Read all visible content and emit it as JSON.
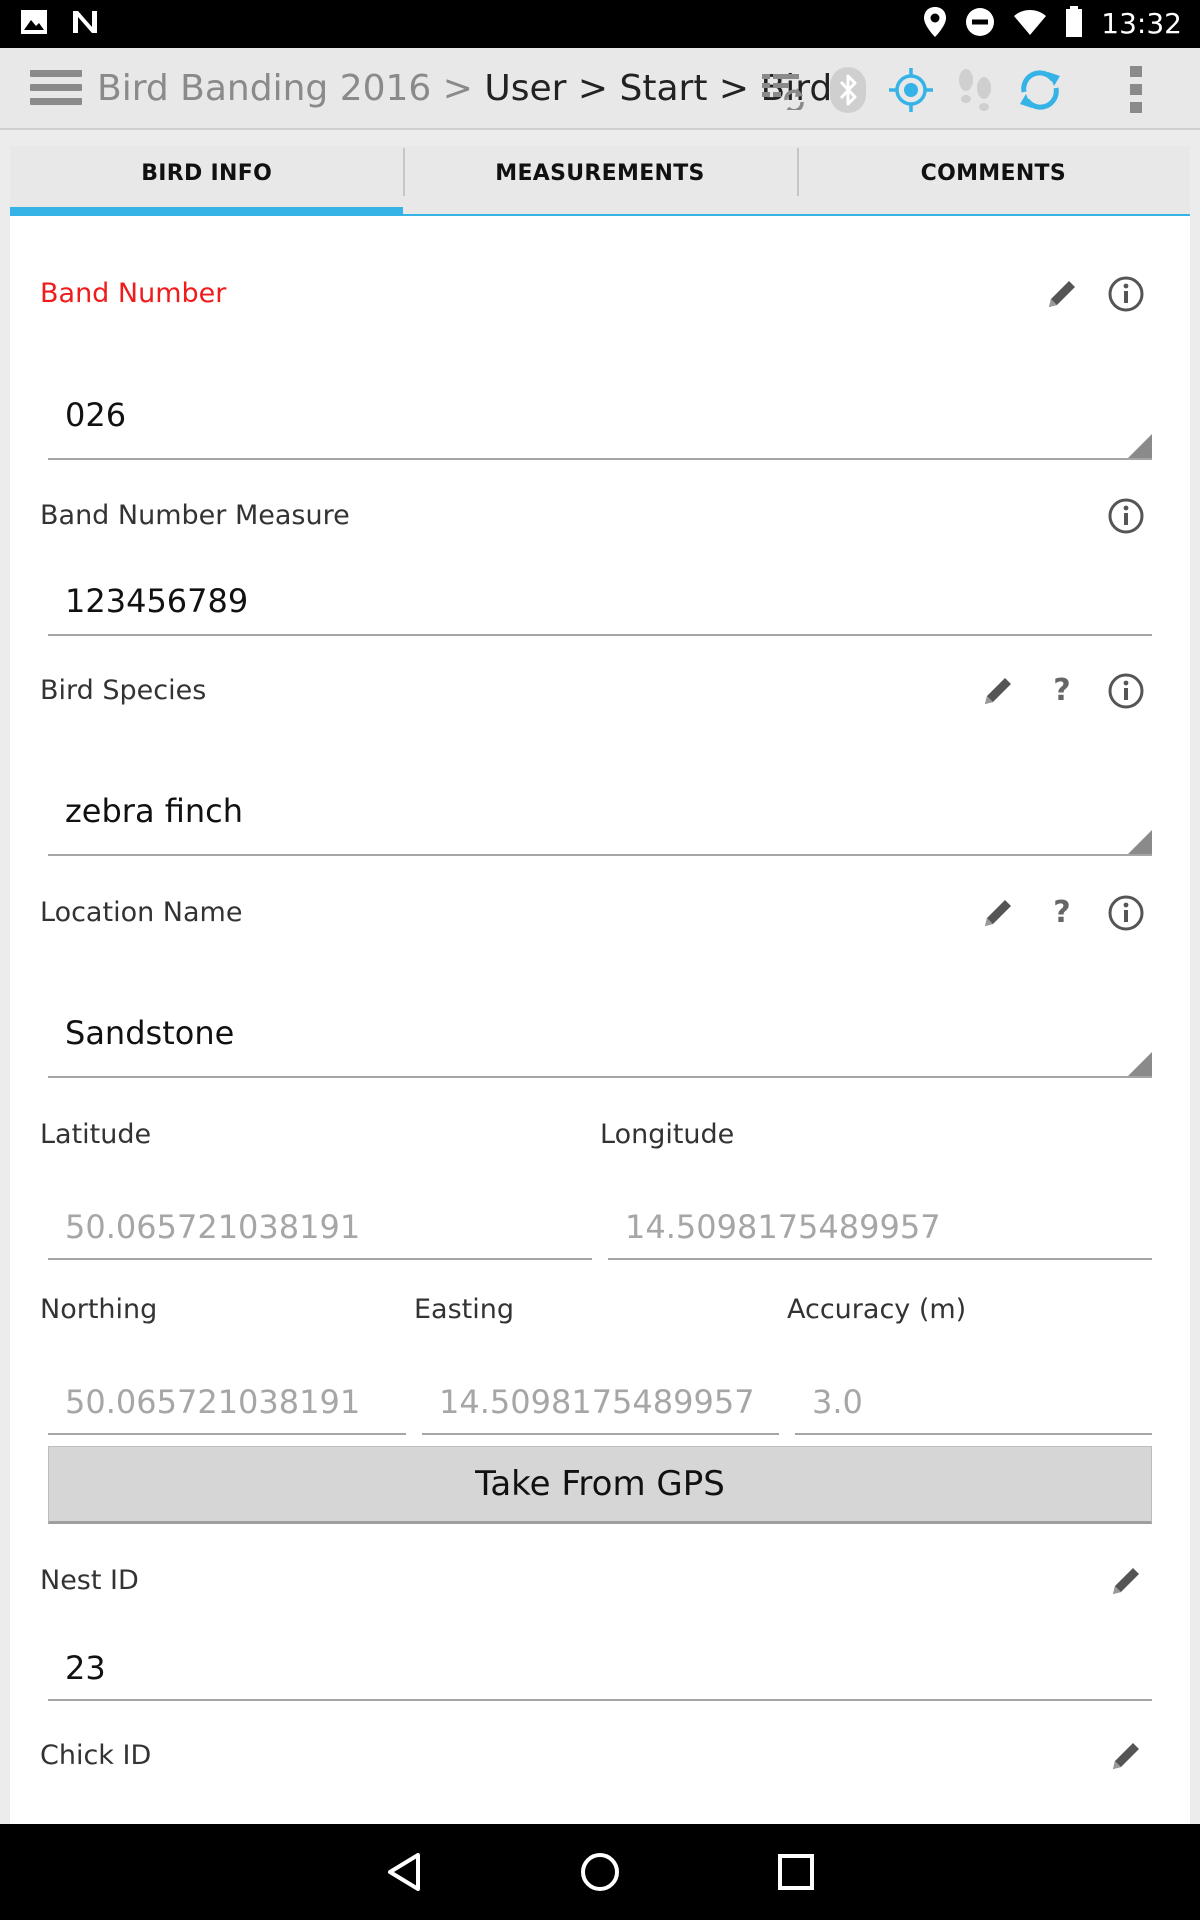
{
  "status_bar": {
    "time": "13:32",
    "icons": [
      "image-icon",
      "n-icon",
      "location-pin-icon",
      "do-not-disturb-icon",
      "wifi-icon",
      "battery-icon"
    ]
  },
  "action_bar": {
    "app_name": "Bird Banding 2016",
    "separator": " > ",
    "path": "User > Start > Bird",
    "icons": [
      "menu-icon",
      "sync-list-icon",
      "bluetooth-icon",
      "gps-target-icon",
      "footsteps-icon",
      "refresh-icon",
      "overflow-menu-icon"
    ],
    "colors": {
      "accent": "#35b3e6",
      "inactive": "#cfcfcf"
    }
  },
  "tabs": [
    {
      "label": "BIRD INFO",
      "active": true
    },
    {
      "label": "MEASUREMENTS",
      "active": false
    },
    {
      "label": "COMMENTS",
      "active": false
    }
  ],
  "form": {
    "band_number": {
      "label": "Band Number",
      "value": "026",
      "required_color": "#f01b1b"
    },
    "band_number_measure": {
      "label": "Band Number Measure",
      "value": "123456789"
    },
    "bird_species": {
      "label": "Bird Species",
      "value": "zebra finch",
      "help": "?"
    },
    "location_name": {
      "label": "Location Name",
      "value": "Sandstone",
      "help": "?"
    },
    "latitude": {
      "label": "Latitude",
      "value": "50.065721038191"
    },
    "longitude": {
      "label": "Longitude",
      "value": "14.5098175489957"
    },
    "northing": {
      "label": "Northing",
      "value": "50.065721038191"
    },
    "easting": {
      "label": "Easting",
      "value": "14.5098175489957"
    },
    "accuracy": {
      "label": "Accuracy (m)",
      "value": "3.0"
    },
    "gps_button": "Take From GPS",
    "nest_id": {
      "label": "Nest ID",
      "value": "23"
    },
    "chick_id": {
      "label": "Chick ID"
    }
  },
  "nav_bar": {
    "icons": [
      "back-icon",
      "home-icon",
      "recents-icon"
    ]
  }
}
